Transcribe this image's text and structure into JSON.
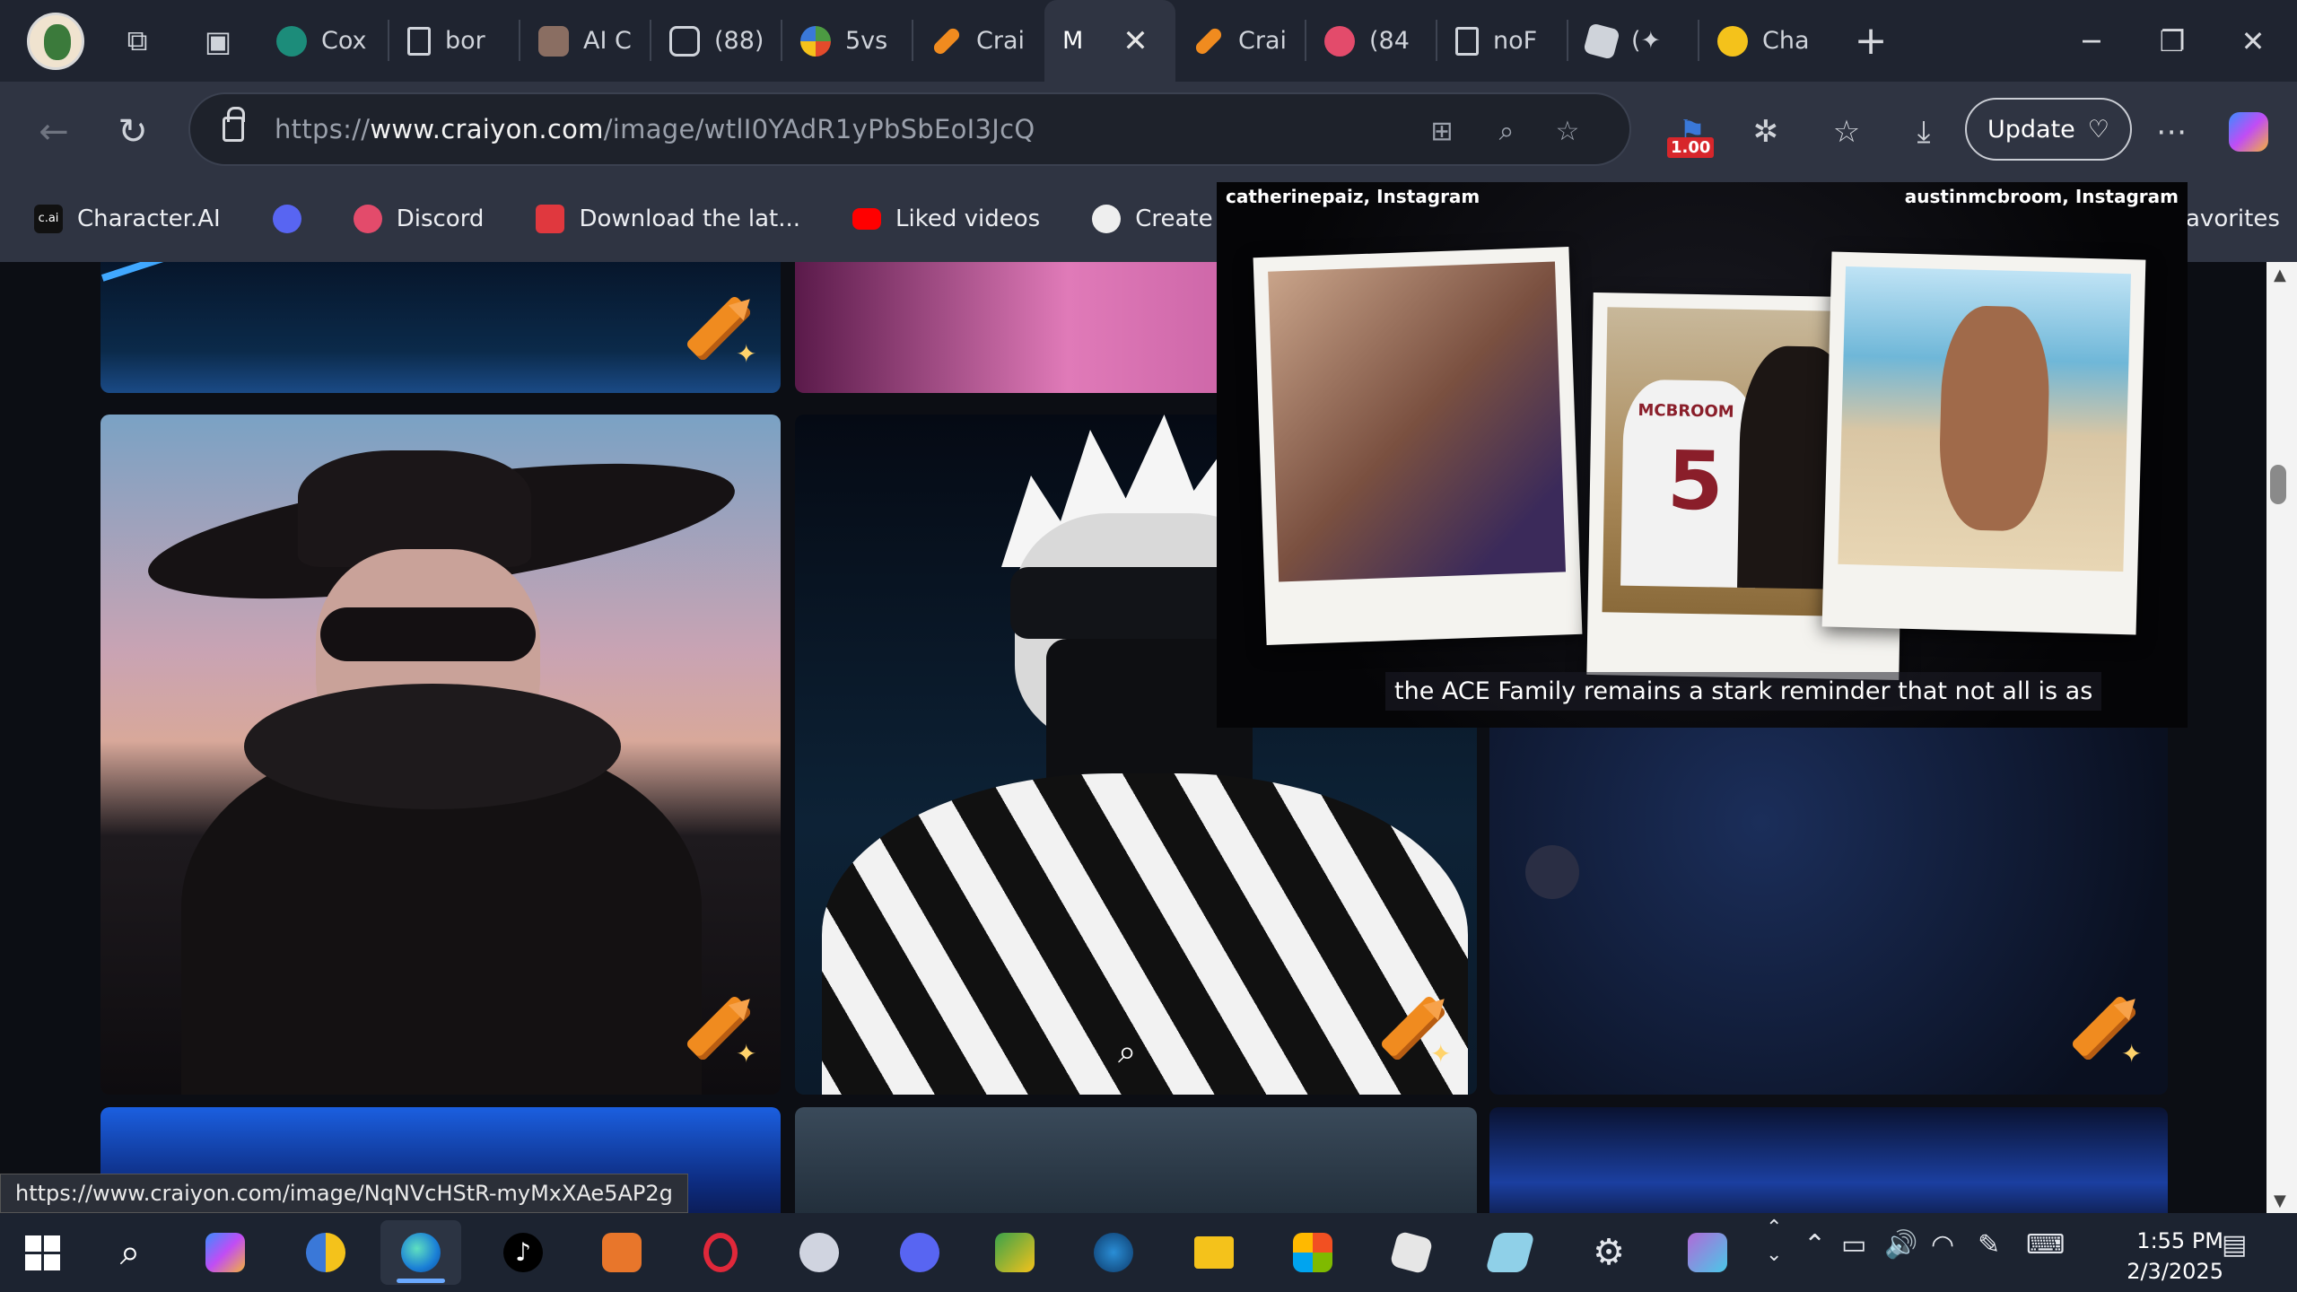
{
  "browser": {
    "tabs": [
      {
        "label": "Cox",
        "fav": "#1c8c7a"
      },
      {
        "label": "bor",
        "fav": "#cfd3da"
      },
      {
        "label": "AI C",
        "fav": "#8a6e62"
      },
      {
        "label": "(88)",
        "fav": "#cfd3da"
      },
      {
        "label": "5vs",
        "fav": "#4c9a42"
      },
      {
        "label": "Crai",
        "fav": "#f08b1f"
      },
      {
        "label": "M",
        "fav": "",
        "active": true
      },
      {
        "label": "Crai",
        "fav": "#f08b1f"
      },
      {
        "label": "(84",
        "fav": "#e34b6b"
      },
      {
        "label": "noF",
        "fav": "#cfd3da"
      },
      {
        "label": "(✦",
        "fav": "#cfd3da"
      },
      {
        "label": "Cha",
        "fav": "#f4c21b"
      }
    ],
    "url_prefix": "https://",
    "url_host": "www.craiyon.com",
    "url_path": "/image/wtlI0YAdR1yPbSbEoI3JcQ",
    "extension_badge": "1.00",
    "update_label": "Update",
    "bookmarks": [
      {
        "label": "Character.AI",
        "color": "#222"
      },
      {
        "label": "",
        "color": "#5865f2"
      },
      {
        "label": "Discord",
        "color": "#e34b6b"
      },
      {
        "label": "Download the lat...",
        "color": "#e0383e"
      },
      {
        "label": "Liked videos",
        "color": "#ff0000"
      },
      {
        "label": "Create Character",
        "color": "#eeeeee"
      }
    ],
    "bookmarks_overflow": "avorites",
    "status_url": "https://www.craiyon.com/image/NqNVcHStR-myMxXAe5AP2g"
  },
  "video_overlay": {
    "credit_left": "catherinepaiz, Instagram",
    "credit_right": "austinmcbroom, Instagram",
    "caption": "the ACE Family remains a stark reminder that not all is as",
    "jersey_text": "MCBROOM",
    "jersey_number": "5"
  },
  "taskbar": {
    "time": "1:55 PM",
    "date": "2/3/2025"
  },
  "colors": {
    "accent": "#6aa9ff",
    "crayon": "#f08b1f",
    "tab_bg": "#1f2430",
    "toolbar_bg": "#2f3442"
  }
}
